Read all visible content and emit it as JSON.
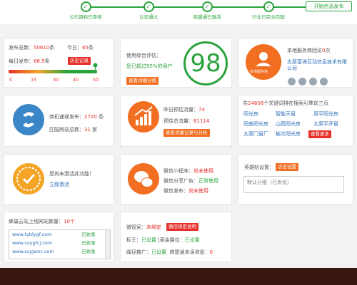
{
  "steps": {
    "items": [
      {
        "label": "公司资料已审核",
        "icon": "check-icon"
      },
      {
        "label": "认证通过",
        "icon": "check-icon"
      },
      {
        "label": "商盟通已激活",
        "icon": "check-icon"
      },
      {
        "label": "行业已完全匹配",
        "icon": "check-icon"
      }
    ],
    "button": "开始信息发布",
    "color": "#2aa33d"
  },
  "publish": {
    "total_label": "发布总数：",
    "total_value": "50610",
    "total_unit": "条",
    "today_label": "今日：",
    "today_value": "65",
    "today_unit": "条",
    "daily_label": "每日发布：",
    "daily_value": "66.9",
    "daily_unit": "条",
    "history_btn": "历史记录",
    "ticks": [
      "0",
      "15",
      "30",
      "40",
      "50"
    ],
    "level": 0.95
  },
  "score": {
    "label": "使用综合评估：",
    "desc": "您已超过95%的用户",
    "detail_btn": "查看详细分值",
    "value": "98"
  },
  "service": {
    "visits_label": "本地服务商回访",
    "visits_value": "0",
    "visits_unit": "次",
    "company": "太原富海互动信息技术有限公司",
    "badge": "本地服务商",
    "icons": [
      "phone-icon",
      "qq-icon",
      "location-icon",
      "clock-icon"
    ]
  },
  "merchant": {
    "send_label": "商机速递发布：",
    "send_value": "2720",
    "send_unit": "条",
    "site_label": "匹配网站总数：",
    "site_value": "31",
    "site_unit": "家"
  },
  "traffic": {
    "yesterday_label": "昨日预估流量：",
    "yesterday_value": "74",
    "total_label": "预估总流量：",
    "total_value": "61114",
    "btn": "查看流量记录与分析"
  },
  "keywords": {
    "prefix": "共",
    "count": "24606",
    "suffix": "个关键词排在搜索引擎前三页",
    "items": [
      "阳光房",
      "智能天窗",
      "原平阳光房",
      "阳曲阳光房",
      "山西阳光房",
      "太原平开窗",
      "太原门窗厂",
      "榆次阳光房"
    ],
    "more_btn": "查看更多"
  },
  "activate": {
    "text": "您尚未激活此功能！",
    "link": "立即激活"
  },
  "wechat": {
    "mini_label": "微信小程序：",
    "mini_value": "尚未使用",
    "share_label": "微信分享广告：",
    "share_value": "正常使用",
    "publish_label": "微信发布：",
    "publish_value": "尚未使用"
  },
  "hero": {
    "label": "英雄帖设置：",
    "btn": "点击设置",
    "placeholder": "默认分组（已优化）"
  },
  "sites": {
    "label": "蜂巢云站上线网站数量：",
    "count": "10个",
    "rows": [
      {
        "url": "www.tyblygf.com",
        "status": "已收录"
      },
      {
        "url": "www.sxygfcj.com",
        "status": "已收录"
      },
      {
        "url": "www.sxjgwsc.com",
        "status": "已收录"
      }
    ]
  },
  "guanjia": {
    "label": "微管家：",
    "value": "未绑定",
    "btn": "微信绑定说明",
    "l2a": "标王：",
    "v2a": "已设置",
    "l2b": "|黄金展位：",
    "v2b": "已设置",
    "l3a": "蹊径推广：",
    "v3a": "已设置",
    "l3b": "商盟通未读询盘：",
    "v3b": "0"
  }
}
